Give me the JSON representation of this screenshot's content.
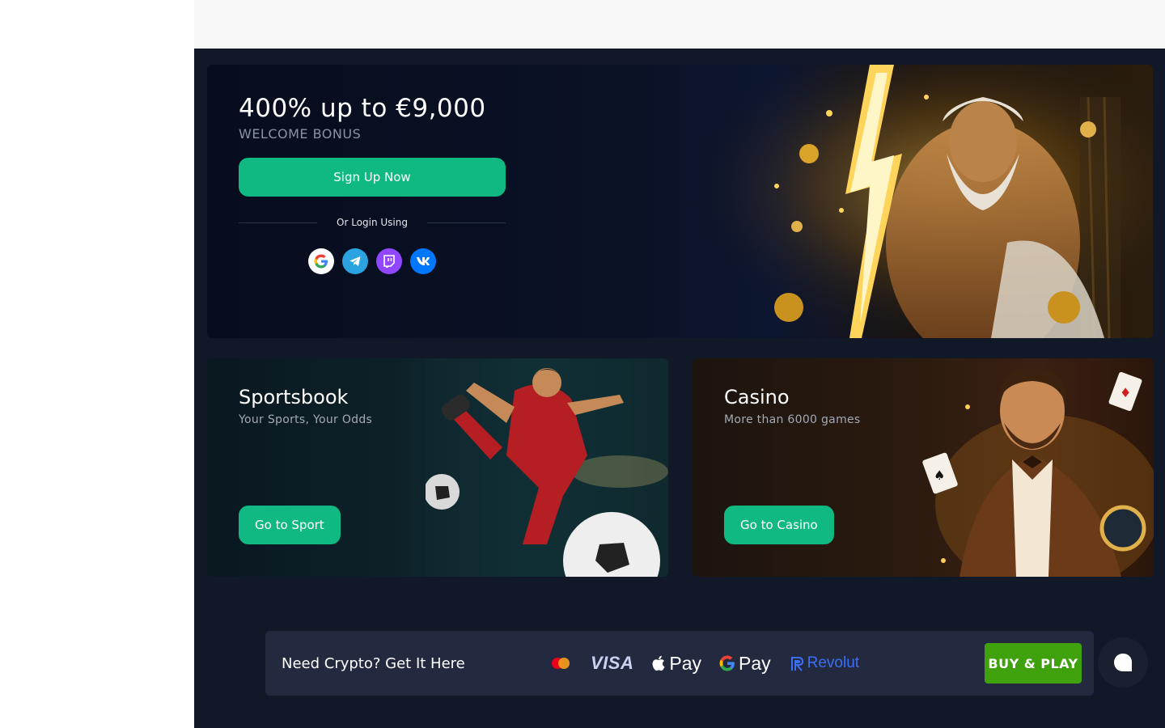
{
  "hero": {
    "title": "400% up to €9,000",
    "subtitle": "WELCOME BONUS",
    "signup_label": "Sign Up Now",
    "login_divider": "Or Login Using",
    "socials": [
      "google-icon",
      "telegram-icon",
      "twitch-icon",
      "vk-icon"
    ]
  },
  "sport": {
    "title": "Sportsbook",
    "subtitle": "Your Sports, Your Odds",
    "button": "Go to Sport"
  },
  "casino": {
    "title": "Casino",
    "subtitle": "More than 6000 games",
    "button": "Go to Casino"
  },
  "crypto": {
    "text": "Need Crypto? Get It Here",
    "visa": "VISA",
    "applepay": "Pay",
    "gpay": "Pay",
    "revolut": "Revolut",
    "buy_label": "BUY & PLAY"
  },
  "colors": {
    "accent": "#10b981",
    "buy": "#3fa10c",
    "background": "#111827"
  }
}
